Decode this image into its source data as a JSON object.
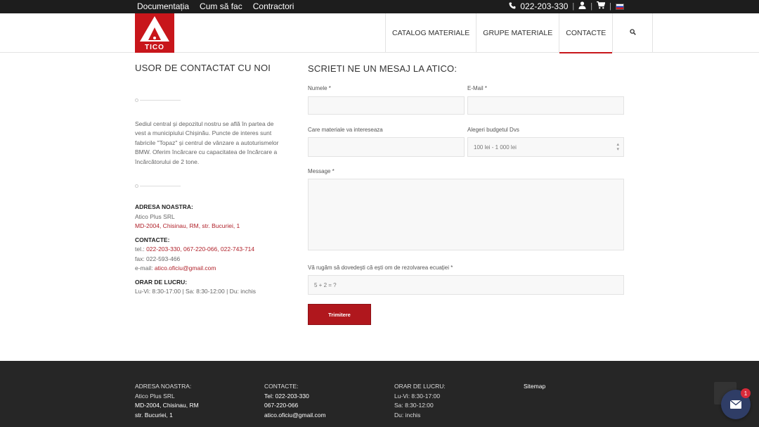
{
  "topbar": {
    "links": [
      "Documentația",
      "Cum să fac",
      "Contractori"
    ],
    "phone": "022-203-330"
  },
  "logo": {
    "text": "TICO"
  },
  "nav": {
    "items": [
      "CATALOG MATERIALE",
      "GRUPE MATERIALE",
      "CONTACTE"
    ],
    "active": "CONTACTE"
  },
  "left": {
    "title": "USOR DE CONTACTAT CU NOI",
    "description": "Sediul central și depozitul nostru se află în partea de vest a municipiului Chișinău. Puncte de interes sunt fabricile \"Topaz\" și centrul de vânzare a autoturismelor BMW. Oferim încărcare cu capacitatea de încărcare a încărcătorului de 2 tone.",
    "address_label": "ADRESA NOASTRA:",
    "address_company": "Atico Plus SRL",
    "address_line": "MD-2004, Chisinau, RM, str. Bucuriei, 1",
    "contacts_label": "CONTACTE:",
    "tel_prefix": "tel.: ",
    "tel_numbers": "022-203-330, 067-220-066, 022-743-714",
    "fax": "fax: 022-593-466",
    "email_prefix": "e-mail: ",
    "email": "atico.oficiu@gmail.com",
    "hours_label": "ORAR DE LUCRU:",
    "hours": "Lu-Vi: 8:30-17:00 | Sa: 8:30-12:00 | Du: inchis"
  },
  "form": {
    "title": "SCRIETI NE UN MESAJ LA ATICO:",
    "name_label": "Numele *",
    "email_label": "E-Mail *",
    "materials_label": "Care materiale va intereseaza",
    "budget_label": "Alegeri budgetul Dvs",
    "budget_selected": "100 lei - 1 000 lei",
    "message_label": "Message *",
    "captcha_label": "Vă rugăm să dovedeşti că eşti om de rezolvarea ecuației *",
    "captcha_value": "5 + 2 = ?",
    "submit_label": "Trimitere"
  },
  "footer": {
    "address_label": "ADRESA NOASTRA:",
    "address_company": "Atico Plus SRL",
    "address_line1": "MD-2004, Chisinau, RM",
    "address_line2": "str. Bucuriei, 1",
    "contacts_label": "CONTACTE:",
    "tel": "Tel: 022-203-330",
    "mobile": "067-220-066",
    "email": "atico.oficiu@gmail.com",
    "hours_label": "ORAR DE LUCRU:",
    "hours_weekday": "Lu-Vi: 8:30-17:00",
    "hours_sat": "Sa: 8:30-12:00",
    "hours_sun": "Du: inchis",
    "sitemap": "Sitemap"
  },
  "chat": {
    "badge": "1"
  },
  "colors": {
    "accent": "#b0171d",
    "topbar": "#1d1d1d",
    "footer": "#262626"
  }
}
